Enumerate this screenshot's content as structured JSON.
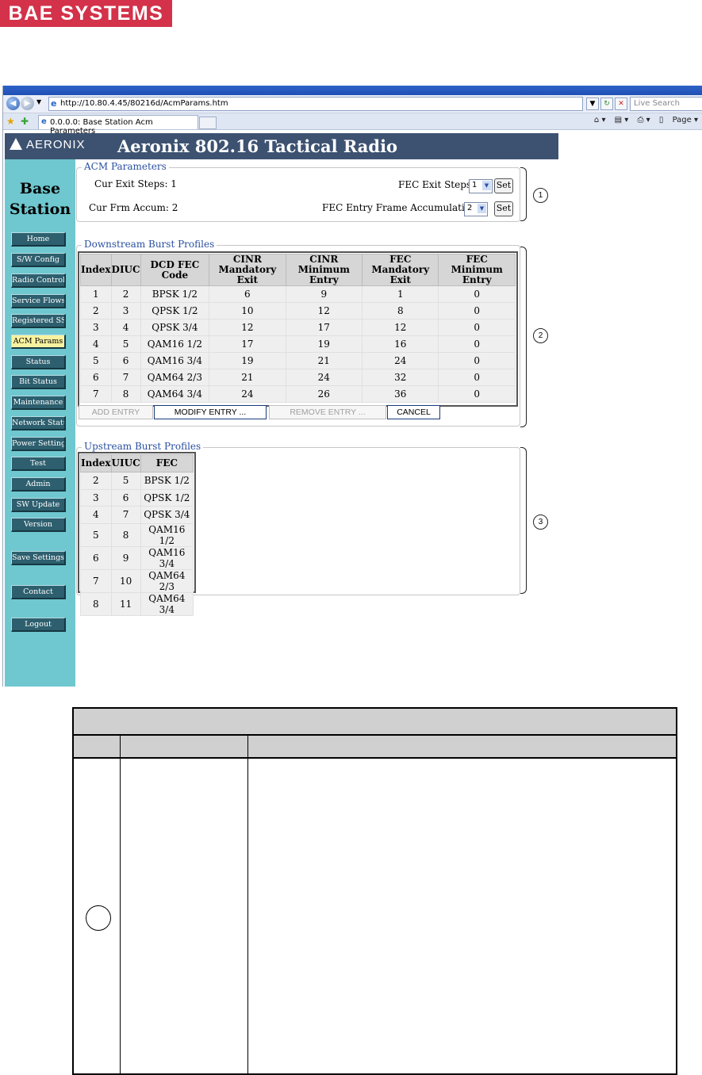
{
  "logo": {
    "text": "BAE SYSTEMS",
    "color": "#d3324a"
  },
  "browser": {
    "url": "http://10.80.4.45/80216d/AcmParams.htm",
    "search_placeholder": "Live Search",
    "tab_title": "0.0.0.0: Base Station Acm Parameters",
    "page_menu": "Page"
  },
  "header": {
    "logo_text": "AERONIX",
    "title": "Aeronix 802.16 Tactical Radio",
    "bg_color": "#3d5271"
  },
  "sidebar": {
    "title_line1": "Base",
    "title_line2": "Station",
    "items": [
      {
        "label": "Home"
      },
      {
        "label": "S/W Config"
      },
      {
        "label": "Radio Control"
      },
      {
        "label": "Service Flows"
      },
      {
        "label": "Registered SSs"
      },
      {
        "label": "ACM Params",
        "active": true
      },
      {
        "label": "Status"
      },
      {
        "label": "Bit Status"
      },
      {
        "label": "Maintenance"
      },
      {
        "label": "Network Status"
      },
      {
        "label": "Power Settings"
      },
      {
        "label": "Test"
      },
      {
        "label": "Admin"
      },
      {
        "label": "SW Update"
      },
      {
        "label": "Version"
      },
      {
        "label": "Save Settings"
      },
      {
        "label": "Contact"
      },
      {
        "label": "Logout"
      }
    ]
  },
  "acm": {
    "legend": "ACM Parameters",
    "cur_exit_steps": "Cur Exit Steps: 1",
    "cur_frm_accum": "Cur Frm Accum: 2",
    "fec_exit_steps_label": "FEC Exit Steps",
    "fec_exit_steps_value": "1",
    "fec_entry_label": "FEC Entry Frame Accumulation",
    "fec_entry_value": "2",
    "set_label": "Set"
  },
  "downstream": {
    "legend": "Downstream Burst Profiles",
    "headers": [
      [
        "Index"
      ],
      [
        "DIUC"
      ],
      [
        "DCD FEC Code"
      ],
      [
        "CINR",
        "Mandatory Exit"
      ],
      [
        "CINR",
        "Minimum Entry"
      ],
      [
        "FEC",
        "Mandatory Exit"
      ],
      [
        "FEC",
        "Minimum Entry"
      ]
    ],
    "rows": [
      [
        "1",
        "2",
        "BPSK 1/2",
        "6",
        "9",
        "1",
        "0"
      ],
      [
        "2",
        "3",
        "QPSK 1/2",
        "10",
        "12",
        "8",
        "0"
      ],
      [
        "3",
        "4",
        "QPSK 3/4",
        "12",
        "17",
        "12",
        "0"
      ],
      [
        "4",
        "5",
        "QAM16 1/2",
        "17",
        "19",
        "16",
        "0"
      ],
      [
        "5",
        "6",
        "QAM16 3/4",
        "19",
        "21",
        "24",
        "0"
      ],
      [
        "6",
        "7",
        "QAM64 2/3",
        "21",
        "24",
        "32",
        "0"
      ],
      [
        "7",
        "8",
        "QAM64 3/4",
        "24",
        "26",
        "36",
        "0"
      ]
    ],
    "buttons": {
      "add": "ADD ENTRY",
      "modify": "MODIFY ENTRY ...",
      "remove": "REMOVE ENTRY ...",
      "cancel": "CANCEL"
    }
  },
  "upstream": {
    "legend": "Upstream Burst Profiles",
    "headers": [
      "Index",
      "UIUC",
      "FEC"
    ],
    "rows": [
      [
        "2",
        "5",
        "BPSK 1/2"
      ],
      [
        "3",
        "6",
        "QPSK 1/2"
      ],
      [
        "4",
        "7",
        "QPSK 3/4"
      ],
      [
        "5",
        "8",
        "QAM16 1/2"
      ],
      [
        "6",
        "9",
        "QAM16 3/4"
      ],
      [
        "7",
        "10",
        "QAM64 2/3"
      ],
      [
        "8",
        "11",
        "QAM64 3/4"
      ]
    ]
  },
  "callouts": [
    "1",
    "2",
    "3"
  ]
}
